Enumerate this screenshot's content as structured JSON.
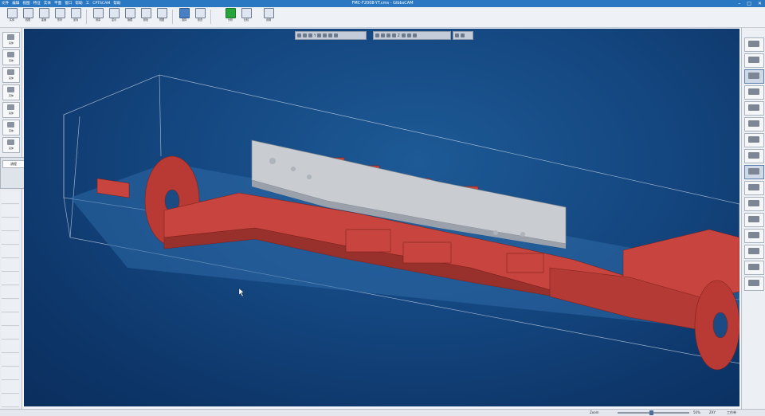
{
  "window": {
    "title": "FMC-F2008-YT.cms - GibbsCAM",
    "menu": [
      "文件",
      "编辑",
      "视图",
      "特征",
      "实体",
      "平面",
      "窗口",
      "帮助",
      "工",
      "CPTSCAM",
      "帮助"
    ],
    "controls": [
      "–",
      "□",
      "✕"
    ]
  },
  "ribbon": {
    "buttons": [
      {
        "label": "实体",
        "icon": "solid-icon"
      },
      {
        "label": "线框",
        "icon": "wire-icon"
      },
      {
        "label": "曲面",
        "icon": "surface-icon"
      },
      {
        "label": "形状",
        "icon": "shape-icon"
      },
      {
        "label": "坐标",
        "icon": "coord-icon"
      },
      {
        "label": "测量",
        "icon": "measure-icon"
      },
      {
        "label": "显示",
        "icon": "display-icon"
      },
      {
        "label": "隐藏",
        "icon": "hide-icon"
      },
      {
        "label": "颜色",
        "icon": "color-icon"
      },
      {
        "label": "视图",
        "icon": "view-icon"
      },
      {
        "label": "选择",
        "icon": "select-icon"
      },
      {
        "label": "检查",
        "icon": "check-icon"
      },
      {
        "label": "分析",
        "icon": "analysis-icon"
      },
      {
        "label": "比较",
        "icon": "compare-icon"
      },
      {
        "label": "设置",
        "icon": "settings-icon"
      }
    ],
    "accent": "#4a7fc4",
    "ok_color": "#26a53a"
  },
  "left_panel": {
    "thumbs": [
      "实体",
      "实体",
      "实体",
      "实体",
      "实体",
      "实体",
      "实体"
    ],
    "panel_title": "流程"
  },
  "viewport": {
    "background": "#14467f",
    "part_color": "#c8443e",
    "workpiece_color": "#c9cdd2",
    "toolbar_left_text": "Y",
    "toolbar_right_text": "Z"
  },
  "status": {
    "left": "Zoom",
    "right_items": [
      "50%",
      "ZXY",
      "工作单"
    ]
  }
}
